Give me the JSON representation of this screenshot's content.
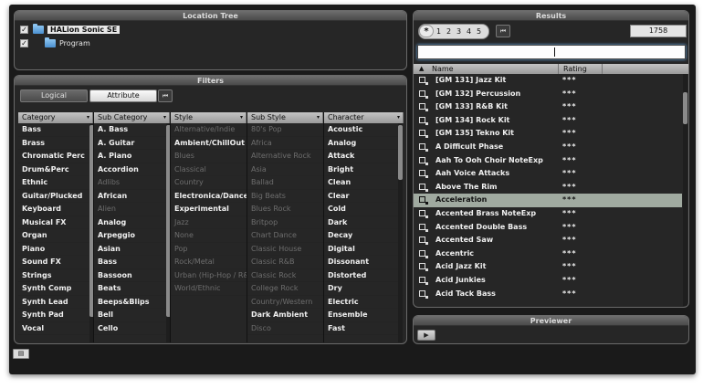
{
  "location_tree": {
    "title": "Location Tree",
    "items": [
      {
        "label": "HALion Sonic SE",
        "checked": true
      },
      {
        "label": "Program",
        "checked": true
      }
    ]
  },
  "filters": {
    "title": "Filters",
    "logical_label": "Logical",
    "attribute_label": "Attribute",
    "columns": [
      {
        "header": "Category",
        "items": [
          "Bass",
          "Brass",
          "Chromatic Perc",
          "Drum&Perc",
          "Ethnic",
          "Guitar/Plucked",
          "Keyboard",
          "Musical FX",
          "Organ",
          "Piano",
          "Sound FX",
          "Strings",
          "Synth Comp",
          "Synth Lead",
          "Synth Pad",
          "Vocal"
        ]
      },
      {
        "header": "Sub Category",
        "items": [
          "A. Bass",
          "A. Guitar",
          "A. Piano",
          "Accordion",
          "Adlibs",
          "African",
          "Alien",
          "Analog",
          "Arpeggio",
          "Asian",
          "Bass",
          "Bassoon",
          "Beats",
          "Beeps&Blips",
          "Bell",
          "Cello"
        ]
      },
      {
        "header": "Style",
        "items": [
          "Alternative/Indie",
          "Ambient/ChillOut",
          "Blues",
          "Classical",
          "Country",
          "Electronica/Dance",
          "Experimental",
          "Jazz",
          "None",
          "Pop",
          "Rock/Metal",
          "Urban (Hip-Hop / R&B)",
          "World/Ethnic"
        ]
      },
      {
        "header": "Sub Style",
        "items": [
          "80's Pop",
          "Africa",
          "Alternative Rock",
          "Asia",
          "Ballad",
          "Big Beats",
          "Blues Rock",
          "Britpop",
          "Chart Dance",
          "Classic House",
          "Classic R&B",
          "Classic Rock",
          "College Rock",
          "Country/Western",
          "Dark Ambient",
          "Disco"
        ]
      },
      {
        "header": "Character",
        "items": [
          "Acoustic",
          "Analog",
          "Attack",
          "Bright",
          "Clean",
          "Clear",
          "Cold",
          "Dark",
          "Decay",
          "Digital",
          "Dissonant",
          "Distorted",
          "Dry",
          "Electric",
          "Ensemble",
          "Fast"
        ]
      }
    ]
  },
  "results": {
    "title": "Results",
    "rating_filter": [
      "1",
      "2",
      "3",
      "4",
      "5"
    ],
    "count": "1758",
    "search_value": "",
    "headers": {
      "name": "Name",
      "rating": "Rating"
    },
    "rows": [
      {
        "name": "[GM 131] Jazz Kit",
        "rating": "***"
      },
      {
        "name": "[GM 132] Percussion",
        "rating": "***"
      },
      {
        "name": "[GM 133] R&B Kit",
        "rating": "***"
      },
      {
        "name": "[GM 134] Rock Kit",
        "rating": "***"
      },
      {
        "name": "[GM 135] Tekno Kit",
        "rating": "***"
      },
      {
        "name": "A Difficult Phase",
        "rating": "***"
      },
      {
        "name": "Aah To Ooh Choir NoteExp",
        "rating": "***"
      },
      {
        "name": "Aah Voice Attacks",
        "rating": "***"
      },
      {
        "name": "Above The Rim",
        "rating": "***"
      },
      {
        "name": "Acceleration",
        "rating": "***"
      },
      {
        "name": "Accented Brass NoteExp",
        "rating": "***"
      },
      {
        "name": "Accented Double Bass",
        "rating": "***"
      },
      {
        "name": "Accented Saw",
        "rating": "***"
      },
      {
        "name": "Accentric",
        "rating": "***"
      },
      {
        "name": "Acid Jazz Kit",
        "rating": "***"
      },
      {
        "name": "Acid Junkies",
        "rating": "***"
      },
      {
        "name": "Acid Tack Bass",
        "rating": "***"
      }
    ],
    "selected_row": "Acceleration"
  },
  "previewer": {
    "title": "Previewer"
  }
}
